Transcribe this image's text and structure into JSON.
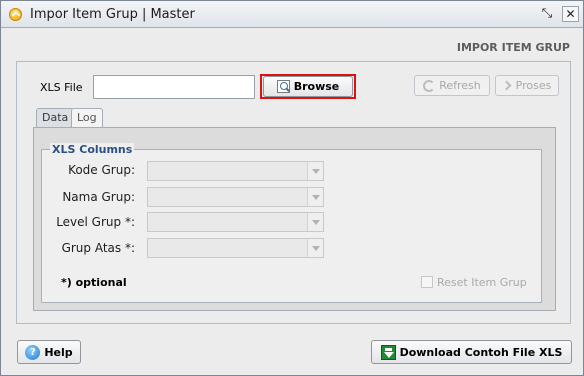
{
  "window": {
    "title": "Impor Item Grup | Master",
    "restore_glyph": "⤡",
    "close_glyph": "✕"
  },
  "header": {
    "label": "IMPOR ITEM GRUP"
  },
  "file": {
    "label": "XLS File",
    "value": "",
    "browse_label": "Browse",
    "refresh_label": "Refresh",
    "proses_label": "Proses"
  },
  "tabs": [
    {
      "label": "Data",
      "active": true
    },
    {
      "label": "Log",
      "active": false
    }
  ],
  "xls_columns": {
    "legend": "XLS Columns",
    "fields": [
      {
        "label": "Kode Grup:",
        "value": ""
      },
      {
        "label": "Nama Grup:",
        "value": ""
      },
      {
        "label": "Level Grup *:",
        "value": ""
      },
      {
        "label": "Grup Atas *:",
        "value": ""
      }
    ],
    "optional_note": "*) optional",
    "reset_label": "Reset Item Grup",
    "reset_checked": false
  },
  "footer": {
    "help_label": "Help",
    "download_label": "Download Contoh File XLS"
  },
  "colors": {
    "legend": "#2b4f86",
    "browse_highlight": "#dd1111",
    "disabled_text": "#a8a8a8"
  },
  "icons": {
    "app": "app-icon",
    "restore": "restore-icon",
    "close": "close-icon",
    "browse": "magnifier-icon",
    "refresh": "refresh-icon",
    "proses": "chevron-right-icon",
    "help": "help-icon",
    "download": "download-excel-icon",
    "combo": "chevron-down-icon"
  }
}
